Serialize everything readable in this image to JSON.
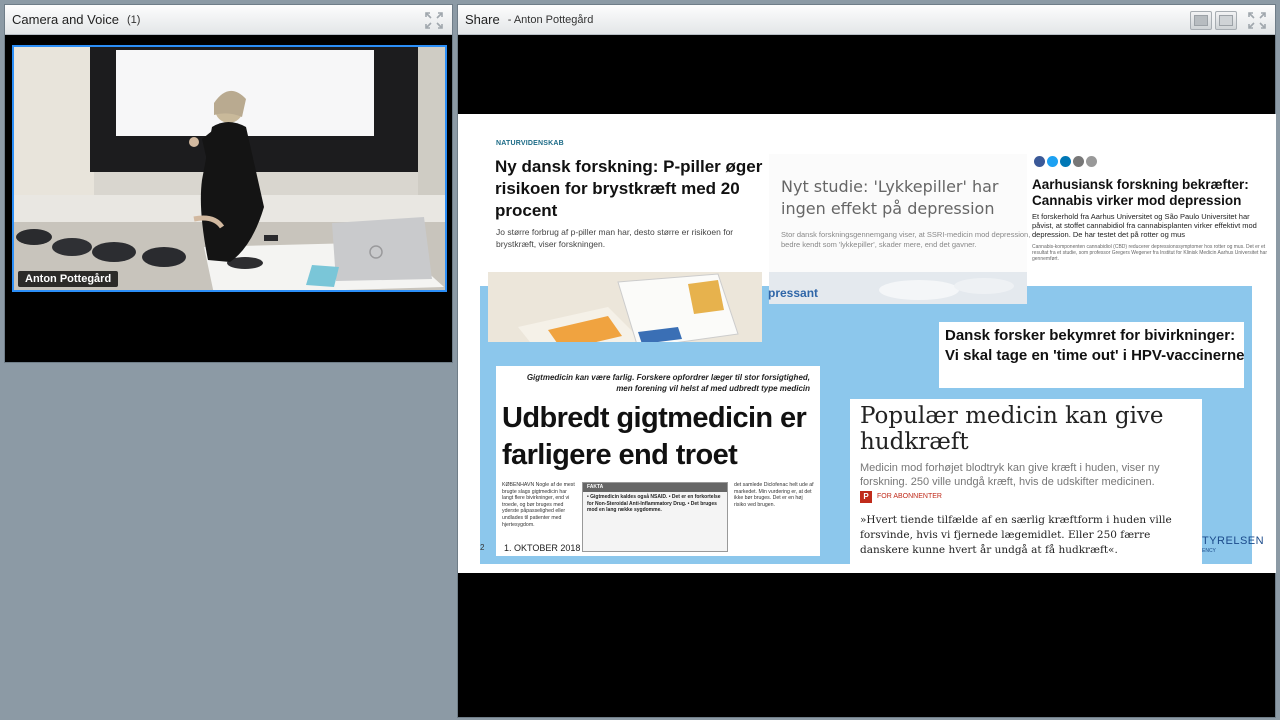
{
  "camera_pod": {
    "title": "Camera and Voice",
    "count": "(1)",
    "speaker_name": "Anton Pottegård"
  },
  "share_pod": {
    "title": "Share",
    "presenter": "- Anton Pottegård"
  },
  "slide": {
    "clip1": {
      "tag": "NATURVIDENSKAB",
      "title": "Ny dansk forskning: P-piller øger risikoen for brystkræft med 20 procent",
      "body": "Jo større forbrug af p-piller man har, desto større er risikoen for brystkræft, viser forskningen."
    },
    "clip2": {
      "title": "Nyt studie: 'Lykkepiller' har ingen effekt på depression",
      "body": "Stor dansk forskningsgennemgang viser, at SSRI-medicin mod depression, bedre kendt som 'lykkepiller', skader mere, end det gavner.",
      "image_word": "pressant"
    },
    "clip3": {
      "title": "Aarhusiansk forskning bekræfter: Cannabis virker mod depression",
      "body": "Et forskerhold fra Aarhus Universitet og São Paulo Universitet har påvist, at stoffet cannabidiol fra cannabisplanten virker effektivt mod depression. De har testet det på rotter og mus",
      "small": "Cannabis-komponenten cannabidiol (CBD) reducerer depressionssymptomer hos rotter og mus. Det er et resultat fra et studie, som professor Gregers Wegener fra Institut for Klinisk Medicin Aarhus Universitet har gennemført."
    },
    "clip4": {
      "title": "Dansk forsker bekymret for bivirkninger: Vi skal tage en 'time out' i HPV-vaccinerne"
    },
    "clip5": {
      "kicker": "Gigtmedicin kan være farlig. Forskere opfordrer læger til stor forsigtighed, men forening vil helst af med udbredt type medicin",
      "title": "Udbredt gigtmedicin er farligere end troet",
      "col1": "KØBENHAVN Nogle af de mest brugte slags gigtmedicin har langt flere bivirkninger, end vi troede, og bør bruges med yderste påpasselighed eller undlades til patienter med hjertesygdom.",
      "fact_head": "FAKTA",
      "fact_body": "• Gigtmedicin kaldes også NSAID. • Det er en forkortelse for Non-Steroidal Anti-Inflammatory Drug. • Det bruges mod en lang række sygdomme.",
      "col3": "det samlede Diclofenac helt ude af markedet. Min vurdering er, at det ikke bør bruges. Det er en høj risiko ved brugen.",
      "date": "1. OKTOBER 2018"
    },
    "clip6": {
      "title": "Populær medicin kan give hudkræft",
      "sub": "Medicin mod forhøjet blodtryk kan give kræft i huden, viser ny forskning. 250 ville undgå kræft, hvis de udskifter medicinen.",
      "badge": "P",
      "abonnent": "FOR ABONNENTER",
      "quote": "»Hvert tiende tilfælde af en særlig kræftform i huden ville forsvinde, hvis vi fjernede lægemidlet. Eller 250 færre danskere kunne hvert år undgå at få hudkræft«."
    },
    "page_number": "2",
    "brand": "TYRELSEN",
    "brand_sub": "ENCY"
  },
  "colors": {
    "accent_blue": "#2b8ef7",
    "slide_blue": "#8cc7ec",
    "background": "#8c9aa5"
  },
  "icons": {
    "fullscreen": "expand-icon",
    "share_buttons": [
      "facebook-icon",
      "twitter-icon",
      "linkedin-icon",
      "mail-icon",
      "print-icon"
    ]
  }
}
